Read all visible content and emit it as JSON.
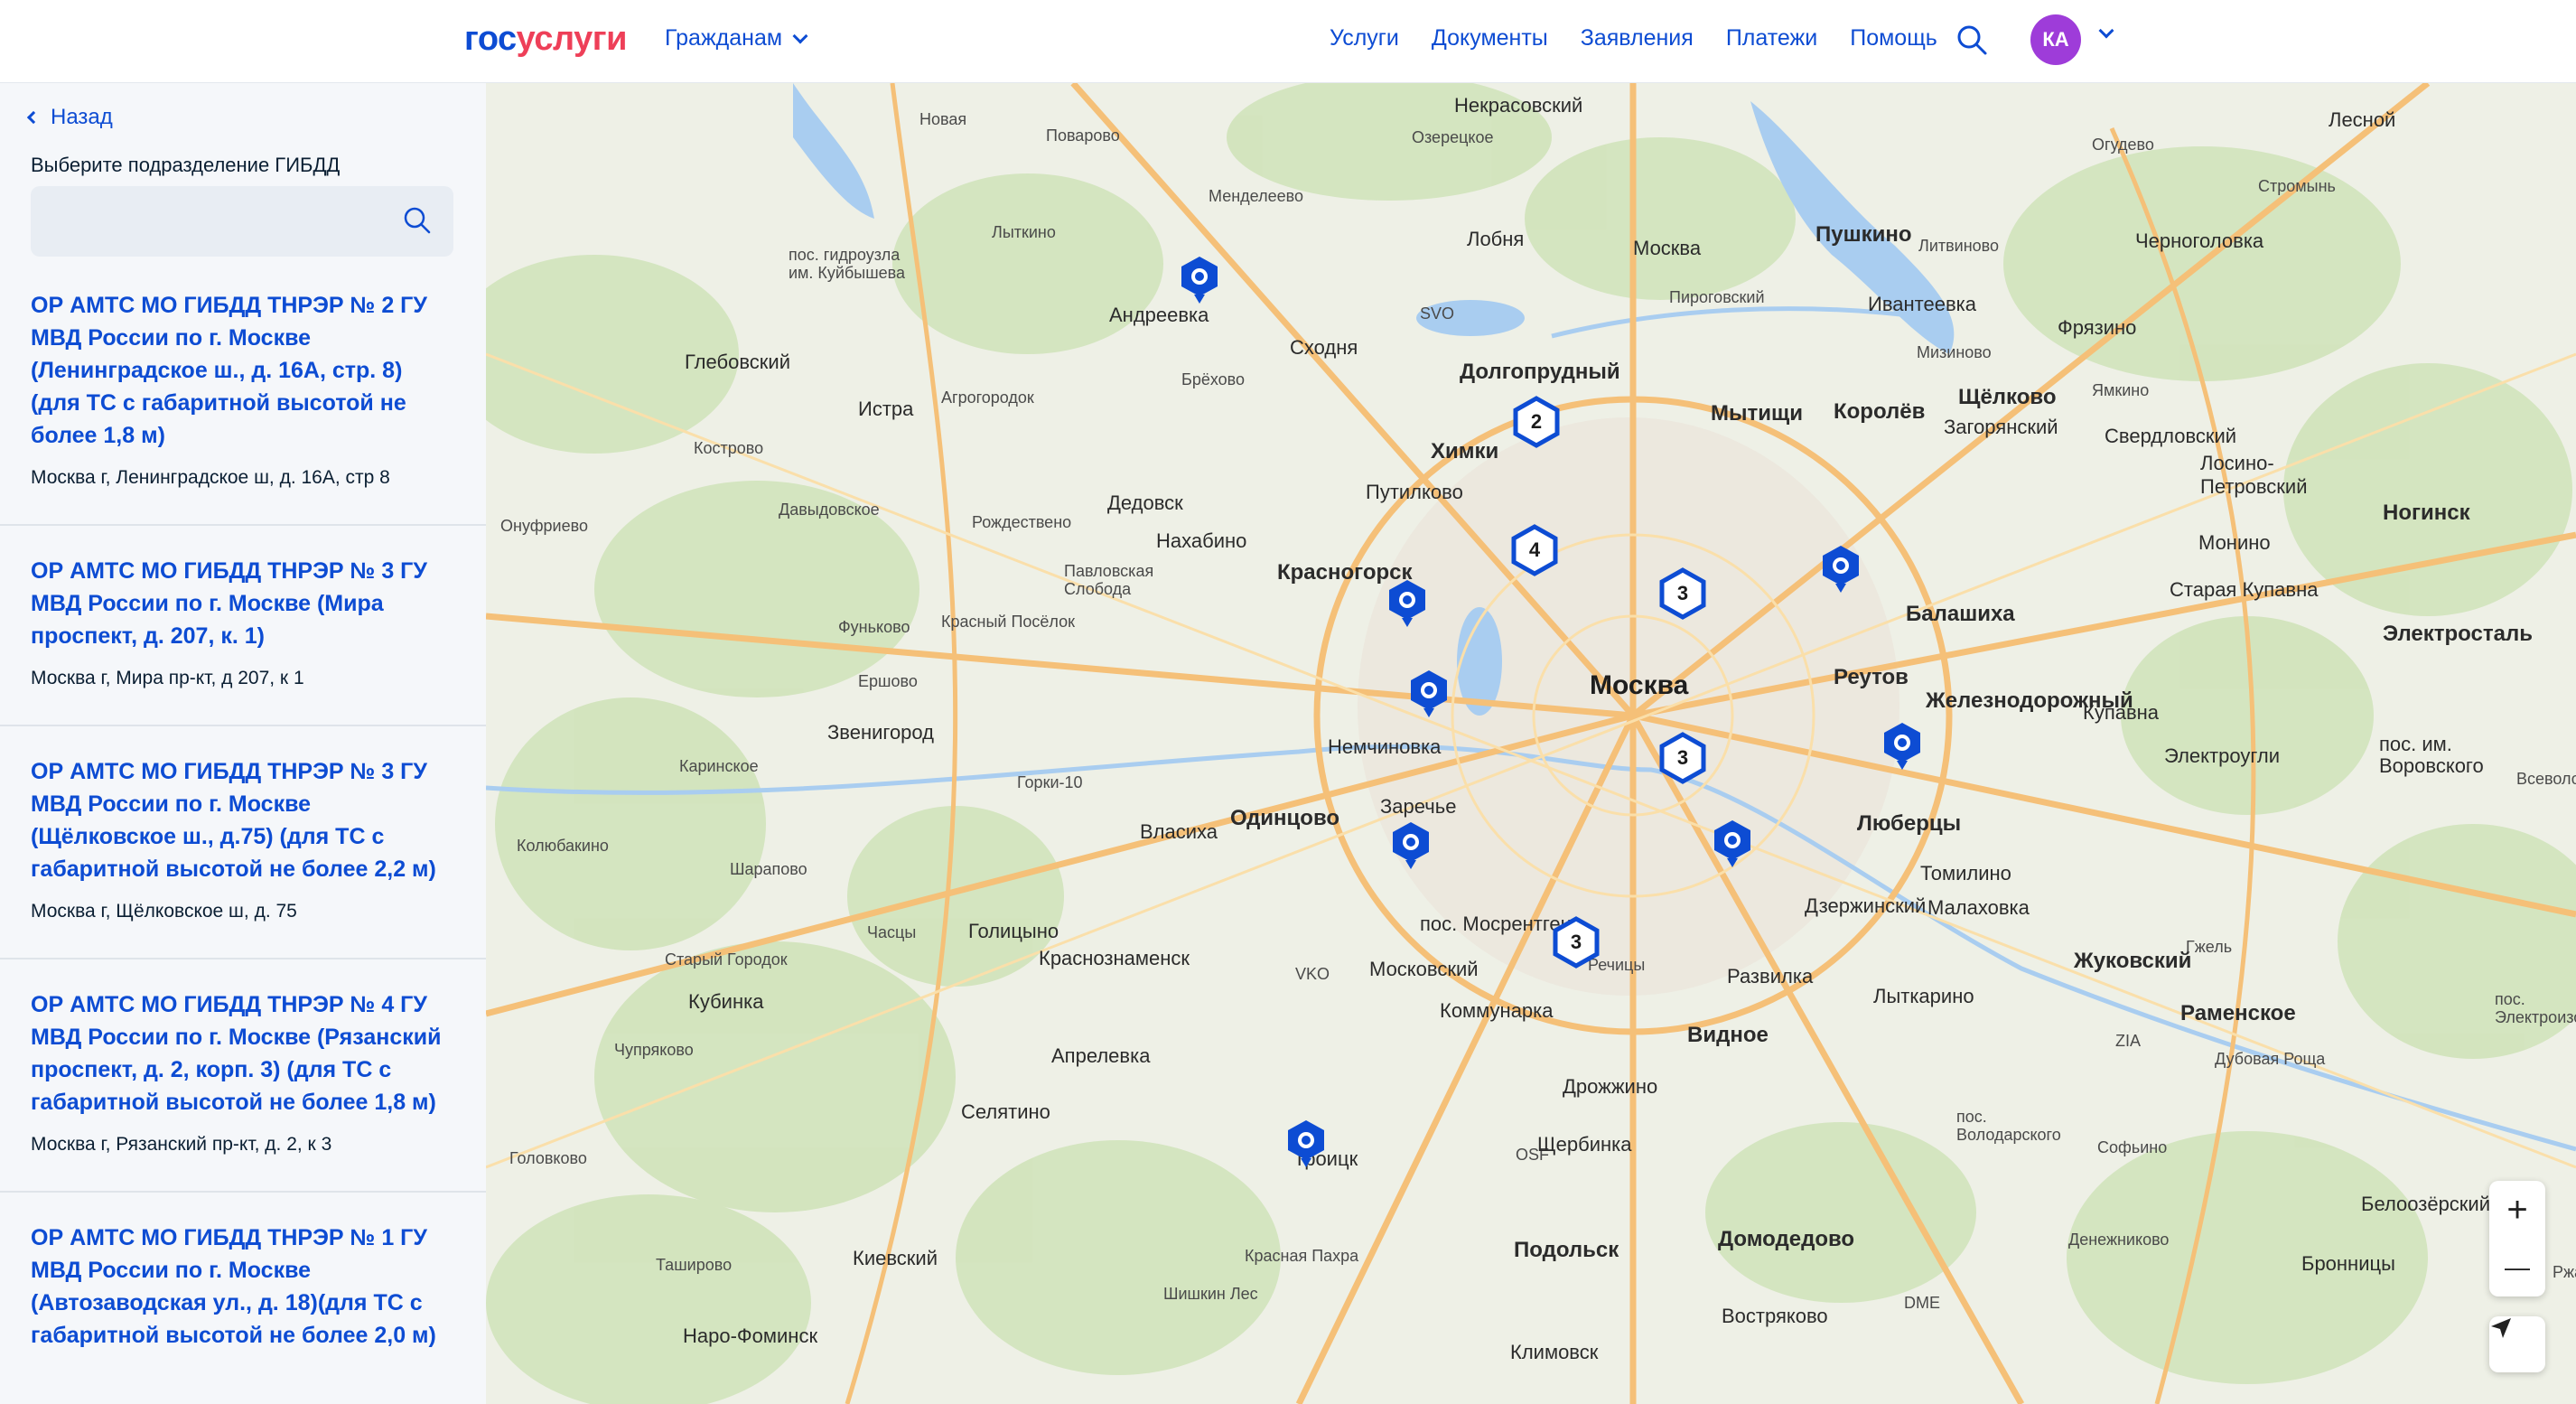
{
  "header": {
    "logo_gos": "гос",
    "logo_uslugi": "услуги",
    "citizens_label": "Гражданам",
    "nav": [
      "Услуги",
      "Документы",
      "Заявления",
      "Платежи",
      "Помощь"
    ],
    "avatar_initials": "КА",
    "avatar_color": "#9e3cd9"
  },
  "sidebar": {
    "back_label": "Назад",
    "field_label": "Выберите подразделение ГИБДД",
    "search_value": "",
    "items": [
      {
        "title": "ОР АМТС МО ГИБДД ТНРЭР № 2 ГУ МВД России по г. Москве (Ленинградское ш., д. 16А, стр. 8) (для ТС с габаритной высотой не более 1,8 м)",
        "address": "Москва г, Ленинградское ш, д. 16А, стр 8"
      },
      {
        "title": "ОР АМТС МО ГИБДД ТНРЭР № 3 ГУ МВД России по г. Москве (Мира проспект, д. 207, к. 1)",
        "address": "Москва г, Мира пр-кт, д 207, к 1"
      },
      {
        "title": "ОР АМТС МО ГИБДД ТНРЭР № 3 ГУ МВД России по г. Москве (Щёлковское ш., д.75) (для ТС с габаритной высотой не более 2,2 м)",
        "address": "Москва г, Щёлковское ш, д. 75"
      },
      {
        "title": "ОР АМТС МО ГИБДД ТНРЭР № 4 ГУ МВД России по г. Москве (Рязанский проспект, д. 2, корп. 3) (для ТС с габаритной высотой не более 1,8 м)",
        "address": "Москва г, Рязанский пр-кт, д. 2, к 3"
      },
      {
        "title": "ОР АМТС МО ГИБДД ТНРЭР № 1 ГУ МВД России по г. Москве (Автозаводская ул., д. 18)(для ТС с габаритной высотой не более 2,0 м)",
        "address": ""
      }
    ]
  },
  "map": {
    "places": [
      {
        "t": "Некрасовский",
        "c": "mid"
      },
      {
        "t": "Лесной",
        "c": "mid"
      },
      {
        "t": "Новая",
        "c": ""
      },
      {
        "t": "Поварово",
        "c": ""
      },
      {
        "t": "Озерецкое",
        "c": ""
      },
      {
        "t": "Менделеево",
        "c": ""
      },
      {
        "t": "Лобня",
        "c": "mid"
      },
      {
        "t": "Москва",
        "c": "mid"
      },
      {
        "t": "Пушкино",
        "c": "big"
      },
      {
        "t": "Черноголовка",
        "c": "mid"
      },
      {
        "t": "Лыткино",
        "c": ""
      },
      {
        "t": "пос. гидроузла им. Куйбышева",
        "c": ""
      },
      {
        "t": "Андреевка",
        "c": "mid"
      },
      {
        "t": "SVO",
        "c": ""
      },
      {
        "t": "Сходня",
        "c": "mid"
      },
      {
        "t": "Пироговский",
        "c": ""
      },
      {
        "t": "Ивантеевка",
        "c": "mid"
      },
      {
        "t": "Фрязино",
        "c": "mid"
      },
      {
        "t": "Глебовский",
        "c": "mid"
      },
      {
        "t": "Брёхово",
        "c": ""
      },
      {
        "t": "Долгопрудный",
        "c": "big"
      },
      {
        "t": "Мытищи",
        "c": "big"
      },
      {
        "t": "Королёв",
        "c": "big"
      },
      {
        "t": "Щёлково",
        "c": "big"
      },
      {
        "t": "Истра",
        "c": "mid"
      },
      {
        "t": "Агрогородок",
        "c": ""
      },
      {
        "t": "Загорянский",
        "c": "mid"
      },
      {
        "t": "Свердловский",
        "c": "mid"
      },
      {
        "t": "Химки",
        "c": "big"
      },
      {
        "t": "Кострово",
        "c": ""
      },
      {
        "t": "Путилково",
        "c": "mid"
      },
      {
        "t": "Дедовск",
        "c": "mid"
      },
      {
        "t": "Лосино-Петровский",
        "c": "mid"
      },
      {
        "t": "Ногинск",
        "c": "big"
      },
      {
        "t": "Давыдовское",
        "c": ""
      },
      {
        "t": "Нахабино",
        "c": "mid"
      },
      {
        "t": "Онуфриево",
        "c": ""
      },
      {
        "t": "Рождествено",
        "c": ""
      },
      {
        "t": "Монино",
        "c": "mid"
      },
      {
        "t": "Красногорск",
        "c": "big"
      },
      {
        "t": "Павловская Слобода",
        "c": ""
      },
      {
        "t": "Старая Купавна",
        "c": "mid"
      },
      {
        "t": "Балашиха",
        "c": "big"
      },
      {
        "t": "Красный Посёлок",
        "c": ""
      },
      {
        "t": "Фуньково",
        "c": ""
      },
      {
        "t": "Электросталь",
        "c": "big"
      },
      {
        "t": "Москва",
        "c": "huge"
      },
      {
        "t": "Реутов",
        "c": "big"
      },
      {
        "t": "Ершово",
        "c": ""
      },
      {
        "t": "Железнодорожный",
        "c": "big"
      },
      {
        "t": "Звенигород",
        "c": "mid"
      },
      {
        "t": "Немчиновка",
        "c": "mid"
      },
      {
        "t": "Купавна",
        "c": "mid"
      },
      {
        "t": "Электроугли",
        "c": "mid"
      },
      {
        "t": "пос. им. Воровского",
        "c": "mid"
      },
      {
        "t": "Каринское",
        "c": ""
      },
      {
        "t": "Горки-10",
        "c": ""
      },
      {
        "t": "Заречье",
        "c": "mid"
      },
      {
        "t": "Одинцово",
        "c": "big"
      },
      {
        "t": "Власиха",
        "c": "mid"
      },
      {
        "t": "Люберцы",
        "c": "big"
      },
      {
        "t": "Колюбакино",
        "c": ""
      },
      {
        "t": "Томилино",
        "c": "mid"
      },
      {
        "t": "Шарапово",
        "c": ""
      },
      {
        "t": "Дзержинский",
        "c": "mid"
      },
      {
        "t": "Малаховка",
        "c": "mid"
      },
      {
        "t": "Часцы",
        "c": ""
      },
      {
        "t": "Голицыно",
        "c": "mid"
      },
      {
        "t": "пос. Мосрентген",
        "c": "mid"
      },
      {
        "t": "Старый Городок",
        "c": ""
      },
      {
        "t": "Краснознаменск",
        "c": "mid"
      },
      {
        "t": "Жуковский",
        "c": "big"
      },
      {
        "t": "VKO",
        "c": ""
      },
      {
        "t": "Московский",
        "c": "mid"
      },
      {
        "t": "Развилка",
        "c": "mid"
      },
      {
        "t": "Кубинка",
        "c": "mid"
      },
      {
        "t": "Лыткарино",
        "c": "mid"
      },
      {
        "t": "Коммунарка",
        "c": "mid"
      },
      {
        "t": "Раменское",
        "c": "big"
      },
      {
        "t": "Чупряково",
        "c": ""
      },
      {
        "t": "Апрелевка",
        "c": "mid"
      },
      {
        "t": "Видное",
        "c": "big"
      },
      {
        "t": "ZIA",
        "c": ""
      },
      {
        "t": "Дубовая Роща",
        "c": ""
      },
      {
        "t": "Селятино",
        "c": "mid"
      },
      {
        "t": "Дрожжино",
        "c": "mid"
      },
      {
        "t": "Головково",
        "c": ""
      },
      {
        "t": "OSF",
        "c": ""
      },
      {
        "t": "Щербинка",
        "c": "mid"
      },
      {
        "t": "пос. Володарского",
        "c": ""
      },
      {
        "t": "Софьино",
        "c": ""
      },
      {
        "t": "Троицк",
        "c": "mid"
      },
      {
        "t": "Белоозёрский",
        "c": "mid"
      },
      {
        "t": "Таширово",
        "c": ""
      },
      {
        "t": "Киевский",
        "c": "mid"
      },
      {
        "t": "Красная Пахра",
        "c": ""
      },
      {
        "t": "Подольск",
        "c": "big"
      },
      {
        "t": "Домодедово",
        "c": "big"
      },
      {
        "t": "Денежниково",
        "c": ""
      },
      {
        "t": "Бронницы",
        "c": "mid"
      },
      {
        "t": "Шишкин Лес",
        "c": ""
      },
      {
        "t": "DME",
        "c": ""
      },
      {
        "t": "Наро-Фоминск",
        "c": "mid"
      },
      {
        "t": "Востряково",
        "c": "mid"
      },
      {
        "t": "Климовск",
        "c": "mid"
      },
      {
        "t": "Огудево",
        "c": ""
      },
      {
        "t": "Стромынь",
        "c": ""
      },
      {
        "t": "Литвиново",
        "c": ""
      },
      {
        "t": "Мизиново",
        "c": ""
      },
      {
        "t": "Ямкино",
        "c": ""
      },
      {
        "t": "Ржавки",
        "c": ""
      },
      {
        "t": "Речицы",
        "c": ""
      },
      {
        "t": "Гжель",
        "c": ""
      },
      {
        "t": "Всеволодово",
        "c": ""
      },
      {
        "t": "пос. Электроизолятор",
        "c": ""
      }
    ],
    "clusters": [
      "2",
      "4",
      "3",
      "3",
      "3"
    ],
    "zoom_in": "+",
    "zoom_out": "—"
  },
  "colors": {
    "primary": "#0d4cd3",
    "logo_red": "#ee3f58",
    "marker": "#0d4cd3"
  }
}
